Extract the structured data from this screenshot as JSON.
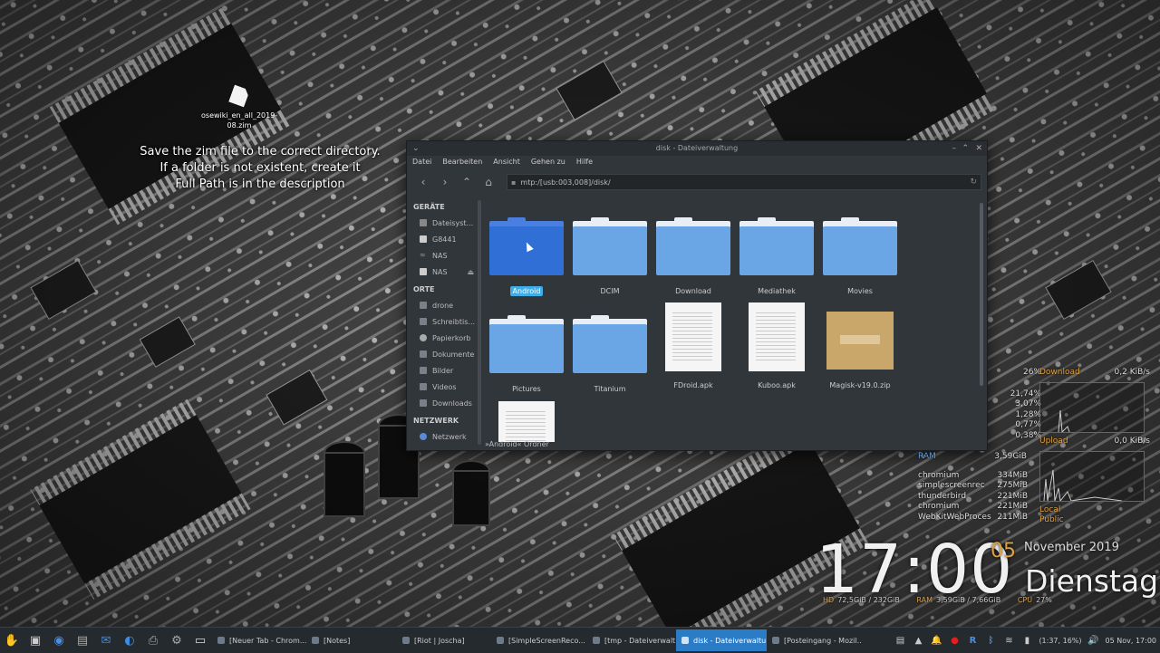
{
  "desktop": {
    "icon_label": "osewiki_en_all_2019-08.zim",
    "overlay_lines": [
      "Save the zim file to the correct directory.",
      "If a folder is not existent, create it",
      "Full Path is in the description"
    ]
  },
  "window": {
    "title": "disk - Dateiverwaltung",
    "menu": [
      "Datei",
      "Bearbeiten",
      "Ansicht",
      "Gehen zu",
      "Hilfe"
    ],
    "address": "mtp:/[usb:003,008]/disk/",
    "sidebar": {
      "sections": [
        {
          "title": "GERÄTE",
          "items": [
            "Dateisyst...",
            "G8441",
            "NAS",
            "NAS"
          ]
        },
        {
          "title": "ORTE",
          "items": [
            "drone",
            "Schreibtis...",
            "Papierkorb",
            "Dokumente",
            "Bilder",
            "Videos",
            "Downloads"
          ]
        },
        {
          "title": "NETZWERK",
          "items": [
            "Netzwerk"
          ]
        }
      ]
    },
    "files": [
      {
        "name": "Android",
        "kind": "folder",
        "selected": true
      },
      {
        "name": "DCIM",
        "kind": "folder"
      },
      {
        "name": "Download",
        "kind": "folder"
      },
      {
        "name": "Mediathek",
        "kind": "folder"
      },
      {
        "name": "Movies",
        "kind": "folder"
      },
      {
        "name": "Pictures",
        "kind": "folder"
      },
      {
        "name": "Titanium",
        "kind": "folder"
      },
      {
        "name": "FDroid.apk",
        "kind": "doc"
      },
      {
        "name": "Kuboo.apk",
        "kind": "doc"
      },
      {
        "name": "Magisk-v19.0.zip",
        "kind": "zip"
      },
      {
        "name": "",
        "kind": "doc"
      }
    ],
    "status": "»Android« Ordner"
  },
  "sysmon": {
    "cpu_total": "26%",
    "cpu_values": [
      "21,74%",
      "3,07%",
      "1,28%",
      "0,77%",
      "0,38%"
    ],
    "download_label": "Download",
    "download_value": "0,2 KiB/s",
    "upload_label": "Upload",
    "upload_value": "0,0 KiB/s",
    "local_label": "Local",
    "public_label": "Public",
    "ram_label": "RAM",
    "ram_value": "3,59GiB",
    "processes": [
      {
        "name": "chromium",
        "mem": "334MiB"
      },
      {
        "name": "simplescreenrec",
        "mem": "275MiB"
      },
      {
        "name": "thunderbird",
        "mem": "221MiB"
      },
      {
        "name": "chromium",
        "mem": "221MiB"
      },
      {
        "name": "WebKitWebProces",
        "mem": "211MiB"
      }
    ]
  },
  "clock": {
    "time": "17:00",
    "day": "05",
    "month_year": "November 2019",
    "weekday": "Dienstag",
    "hd_label": "HD",
    "hd_value": "72,5GiB / 232GiB",
    "ram_label": "RAM",
    "ram_value": "3,59GiB / 7,66GiB",
    "cpu_label": "CPU",
    "cpu_value": "27%"
  },
  "taskbar": {
    "tasks": [
      {
        "label": "[Neuer Tab - Chrom..."
      },
      {
        "label": "[Notes]"
      },
      {
        "label": "[Riot | Joscha]"
      },
      {
        "label": "[SimpleScreenReco..."
      },
      {
        "label": "[tmp - Dateiverwalt..."
      },
      {
        "label": "disk - Dateiverwaltu...",
        "active": true
      },
      {
        "label": "[Posteingang - Mozil..."
      }
    ],
    "battery": "(1:37, 16%)",
    "datetime": "05 Nov, 17:00"
  },
  "colors": {
    "accent": "#3daee9",
    "folder": "#6aa5e6",
    "highlight": "#e0a040"
  }
}
